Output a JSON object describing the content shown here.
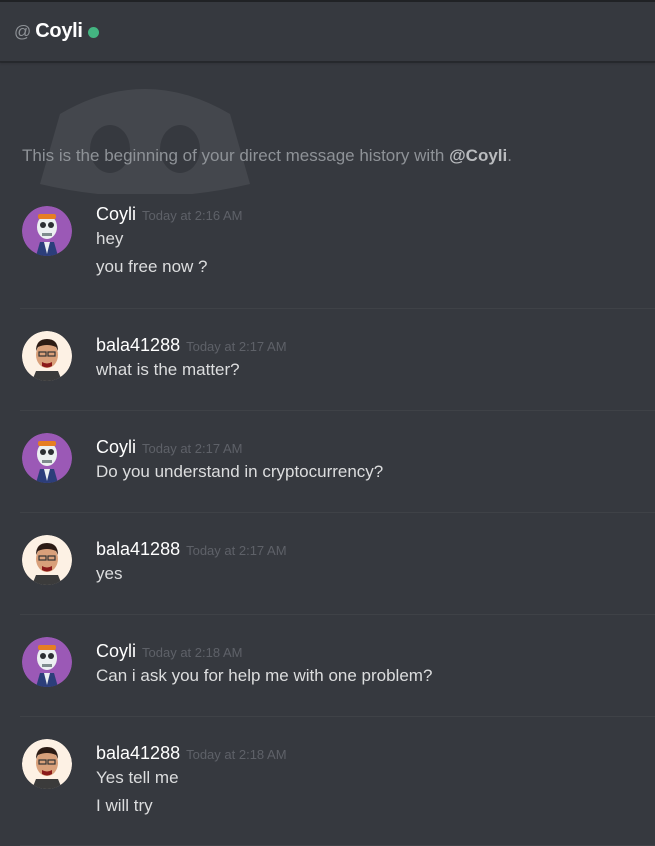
{
  "header": {
    "at_symbol": "@",
    "name": "Coyli",
    "status_color": "#43b581"
  },
  "intro": {
    "prefix": "This is the beginning of your direct message history with ",
    "mention": "@Coyli",
    "suffix": "."
  },
  "colors": {
    "background": "#36393f",
    "username": "#ffffff",
    "timestamp": "#5e6168",
    "message": "#dcddde",
    "online": "#43b581"
  },
  "messages": [
    {
      "author": "Coyli",
      "avatar": "skeleton-avatar",
      "time": "Today at 2:16 AM",
      "lines": [
        "hey",
        "you free now ?"
      ]
    },
    {
      "author": "bala41288",
      "avatar": "man-avatar",
      "time": "Today at 2:17 AM",
      "lines": [
        "what is the matter?"
      ]
    },
    {
      "author": "Coyli",
      "avatar": "skeleton-avatar",
      "time": "Today at 2:17 AM",
      "lines": [
        "Do you understand in cryptocurrency?"
      ]
    },
    {
      "author": "bala41288",
      "avatar": "man-avatar",
      "time": "Today at 2:17 AM",
      "lines": [
        "yes"
      ]
    },
    {
      "author": "Coyli",
      "avatar": "skeleton-avatar",
      "time": "Today at 2:18 AM",
      "lines": [
        "Can i ask you for help me with one problem?"
      ]
    },
    {
      "author": "bala41288",
      "avatar": "man-avatar",
      "time": "Today at 2:18 AM",
      "lines": [
        "Yes tell me",
        "I will try"
      ]
    }
  ]
}
